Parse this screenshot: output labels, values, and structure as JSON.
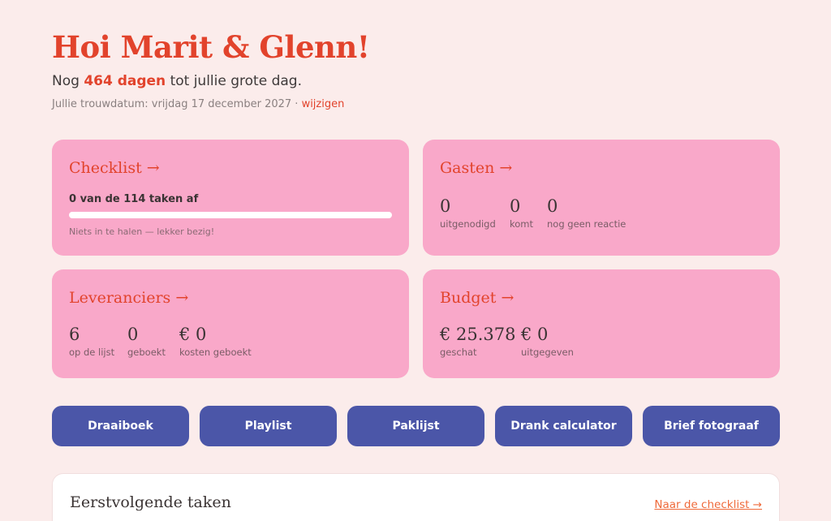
{
  "header": {
    "greeting": "Hoi Marit & Glenn!",
    "countdown_prefix": "Nog ",
    "countdown_days": "464 dagen",
    "countdown_suffix": " tot jullie grote dag.",
    "date_text": "Jullie trouwdatum: vrijdag 17 december 2027 · ",
    "change_link": "wijzigen"
  },
  "cards": {
    "checklist": {
      "title": "Checklist →",
      "progress_label": "0 van de 114 taken af",
      "progress_done": 0,
      "progress_total": 114,
      "note": "Niets in te halen — lekker bezig!"
    },
    "gasten": {
      "title": "Gasten →",
      "stats": [
        {
          "value": "0",
          "label": "uitgenodigd"
        },
        {
          "value": "0",
          "label": "komt"
        },
        {
          "value": "0",
          "label": "nog geen reactie"
        }
      ]
    },
    "leveranciers": {
      "title": "Leveranciers →",
      "stats": [
        {
          "value": "6",
          "label": "op de lijst"
        },
        {
          "value": "0",
          "label": "geboekt"
        },
        {
          "value": "€ 0",
          "label": "kosten geboekt"
        }
      ]
    },
    "budget": {
      "title": "Budget →",
      "stats": [
        {
          "value": "€ 25.378",
          "label": "geschat"
        },
        {
          "value": "€ 0",
          "label": "uitgegeven"
        }
      ]
    }
  },
  "buttons": [
    "Draaiboek",
    "Playlist",
    "Paklijst",
    "Drank calculator",
    "Brief fotograaf"
  ],
  "tasks": {
    "title": "Eerstvolgende taken",
    "link": "Naar de checklist →"
  },
  "colors": {
    "accent": "#e2432c",
    "card": "#f9a8c9",
    "button": "#4b56a8",
    "background": "#fbeceb"
  }
}
